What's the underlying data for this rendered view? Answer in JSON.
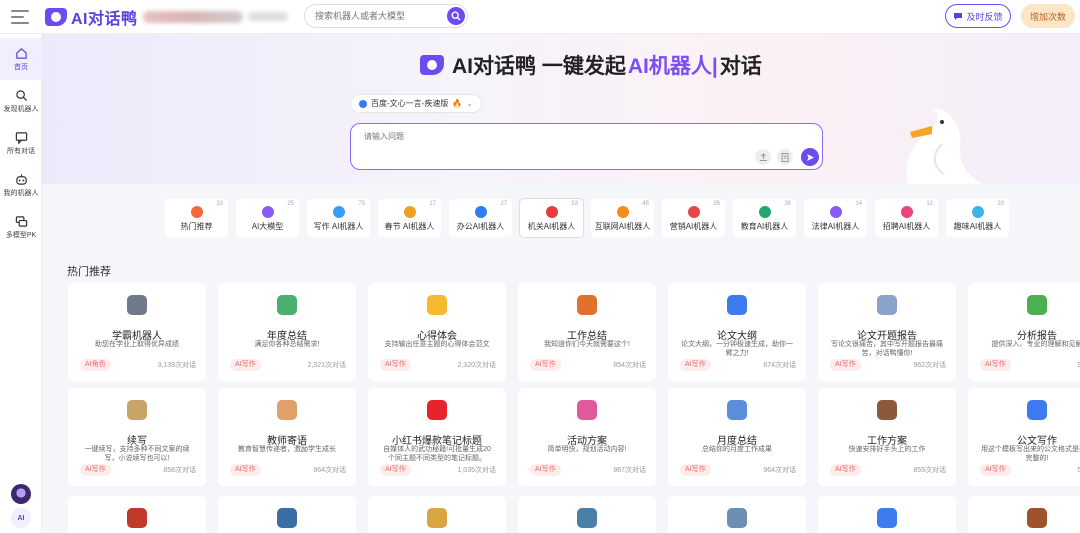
{
  "brand": {
    "name": "AI对话鸭",
    "accent": "#6c4cf0"
  },
  "search": {
    "placeholder": "搜索机器人或者大模型"
  },
  "header": {
    "feedback_label": "及时反馈",
    "add_label": "增加次数"
  },
  "sidebar": {
    "items": [
      {
        "label": "首页",
        "icon": "home-icon"
      },
      {
        "label": "发现机器人",
        "icon": "search-icon"
      },
      {
        "label": "所有对话",
        "icon": "chat-icon"
      },
      {
        "label": "我的机器人",
        "icon": "robot-icon"
      },
      {
        "label": "多模型PK",
        "icon": "compare-icon"
      }
    ],
    "bottom_avatar_label": "AI"
  },
  "hero": {
    "title_prefix": "AI对话鸭 一键发起",
    "title_accent": "AI机器人|",
    "title_suffix": "对话",
    "model": "百度-文心一言-疾速版",
    "ask_placeholder": "请输入问题"
  },
  "categories": [
    {
      "label": "热门推荐",
      "count": "33",
      "color": "#f56a3c"
    },
    {
      "label": "AI大模型",
      "count": "25",
      "color": "#8a5cf6"
    },
    {
      "label": "写作 AI机器人",
      "count": "75",
      "color": "#3b9cf5"
    },
    {
      "label": "春节 AI机器人",
      "count": "17",
      "color": "#f0a020"
    },
    {
      "label": "办公AI机器人",
      "count": "27",
      "color": "#2f7cf6"
    },
    {
      "label": "机关AI机器人",
      "count": "53",
      "color": "#e83b3b"
    },
    {
      "label": "互联网AI机器人",
      "count": "45",
      "color": "#f58a1f"
    },
    {
      "label": "营销AI机器人",
      "count": "35",
      "color": "#e84646"
    },
    {
      "label": "教育AI机器人",
      "count": "36",
      "color": "#1fa971"
    },
    {
      "label": "法律AI机器人",
      "count": "14",
      "color": "#8a5cf6"
    },
    {
      "label": "招聘AI机器人",
      "count": "12",
      "color": "#e8467a"
    },
    {
      "label": "趣味AI机器人",
      "count": "20",
      "color": "#38b6e8"
    }
  ],
  "section_title": "热门推荐",
  "cards_row1": [
    {
      "title": "学霸机器人",
      "desc": "助您在学业上取得优异成绩",
      "tag": "AI角色",
      "uses": "3,139次对话",
      "color": "#6f7a8a"
    },
    {
      "title": "年度总结",
      "desc": "满足你各种总结需求!",
      "tag": "AI写作",
      "uses": "2,321次对话",
      "color": "#4caf72"
    },
    {
      "title": "心得体会",
      "desc": "支持输出任意主题的心得体会范文",
      "tag": "AI写作",
      "uses": "2,320次对话",
      "color": "#f5b82e"
    },
    {
      "title": "工作总结",
      "desc": "我知道你们今天就需要这个!",
      "tag": "AI写作",
      "uses": "854次对话",
      "color": "#e0702e"
    },
    {
      "title": "论文大纲",
      "desc": "论文大纲，一分钟极速生成，助你一臂之力!",
      "tag": "AI写作",
      "uses": "674次对话",
      "color": "#3d7bf0"
    },
    {
      "title": "论文开题报告",
      "desc": "写论文很痛苦，其中写开题报告最痛苦，对话鸭懂你!",
      "tag": "AI写作",
      "uses": "962次对话",
      "color": "#8aa3c8"
    },
    {
      "title": "分析报告",
      "desc": "提供深入、专业的理解和见解",
      "tag": "AI写作",
      "uses": "973次",
      "color": "#4caf50"
    }
  ],
  "cards_row2": [
    {
      "title": "续写",
      "desc": "一键续写，支持多种不同文案的续写，小说续写也可以!",
      "tag": "AI写作",
      "uses": "858次对话",
      "color": "#c9a46a"
    },
    {
      "title": "教师寄语",
      "desc": "教育智慧传递者，激励学生成长",
      "tag": "AI写作",
      "uses": "864次对话",
      "color": "#e0a06a"
    },
    {
      "title": "小红书爆款笔记标题",
      "desc": "自媒体人的武功秘籍!可批量生成20个同主题不同类型的笔记标题。",
      "tag": "AI写作",
      "uses": "1,035次对话",
      "color": "#e8232b"
    },
    {
      "title": "活动方案",
      "desc": "简单明快，规划活动内容!",
      "tag": "AI写作",
      "uses": "967次对话",
      "color": "#e05a9a"
    },
    {
      "title": "月度总结",
      "desc": "总结你的月度工作成果",
      "tag": "AI写作",
      "uses": "964次对话",
      "color": "#5b8dd8"
    },
    {
      "title": "工作方案",
      "desc": "快速安排好手头上的工作",
      "tag": "AI写作",
      "uses": "859次对话",
      "color": "#8a5a3a"
    },
    {
      "title": "公文写作",
      "desc": "用这个模板写出来的公文格式是非常完整的!",
      "tag": "AI写作",
      "uses": "589次",
      "color": "#3d7bf0"
    }
  ],
  "cards_row3_colors": [
    "#c0392b",
    "#3a6ea5",
    "#d9a441",
    "#4a7fa8",
    "#6b8fb3",
    "#3d7bf0",
    "#a0522d"
  ]
}
